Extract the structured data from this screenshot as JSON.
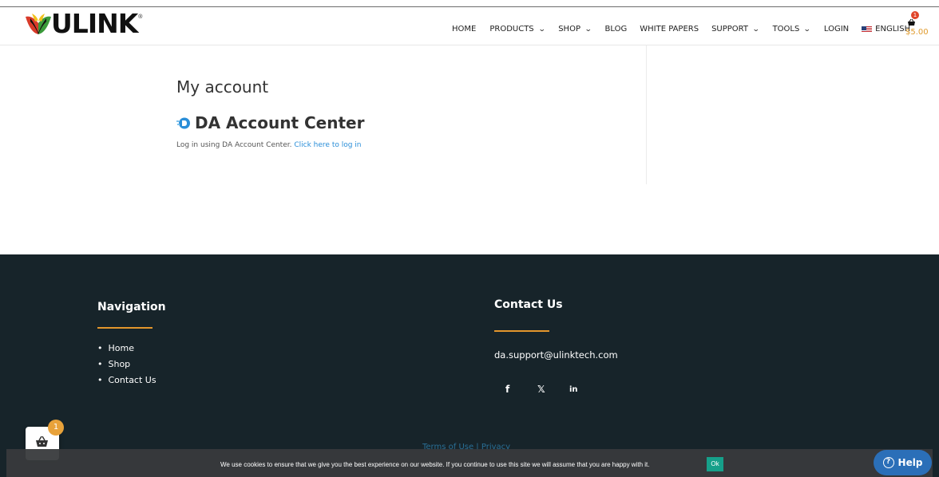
{
  "header": {
    "logo_text": "ULINK",
    "logo_reg": "®",
    "nav": [
      {
        "label": "HOME",
        "dropdown": false
      },
      {
        "label": "PRODUCTS",
        "dropdown": true
      },
      {
        "label": "SHOP",
        "dropdown": true
      },
      {
        "label": "BLOG",
        "dropdown": false
      },
      {
        "label": "WHITE PAPERS",
        "dropdown": false
      },
      {
        "label": "SUPPORT",
        "dropdown": true
      },
      {
        "label": "TOOLS",
        "dropdown": true
      },
      {
        "label": "LOGIN",
        "dropdown": false
      },
      {
        "label": "ENGLISH",
        "dropdown": false,
        "flag": "us-flag-icon"
      }
    ],
    "cart": {
      "count": "1",
      "total": "$5.00",
      "icon": "basket-icon"
    }
  },
  "main": {
    "title": "My account",
    "da_title": "DA Account Center",
    "login_text": "Log in using DA Account Center.",
    "login_link": "Click here to log in"
  },
  "footer": {
    "nav_heading": "Navigation",
    "nav_items": [
      "Home",
      "Shop",
      "Contact Us"
    ],
    "contact_heading": "Contact Us",
    "email": "da.support@ulinktech.com",
    "social": [
      {
        "name": "facebook-icon",
        "glyph": "f"
      },
      {
        "name": "x-twitter-icon",
        "glyph": "𝕏"
      },
      {
        "name": "linkedin-icon",
        "glyph": "in"
      }
    ],
    "bottom_text": "Terms of Use | Privacy"
  },
  "floating_cart": {
    "count": "1",
    "icon": "basket-icon"
  },
  "cookie": {
    "text": "We use cookies to ensure that we give you the best experience on our website. If you continue to use this site we will assume that you are happy with it.",
    "ok_label": "Ok"
  },
  "help": {
    "label": "Help",
    "icon": "question-icon"
  },
  "colors": {
    "accent_orange": "#e3962c",
    "link_blue": "#2a8ed8",
    "footer_bg": "#17242a",
    "help_blue": "#2b6fb8",
    "ok_green": "#16a08a"
  }
}
